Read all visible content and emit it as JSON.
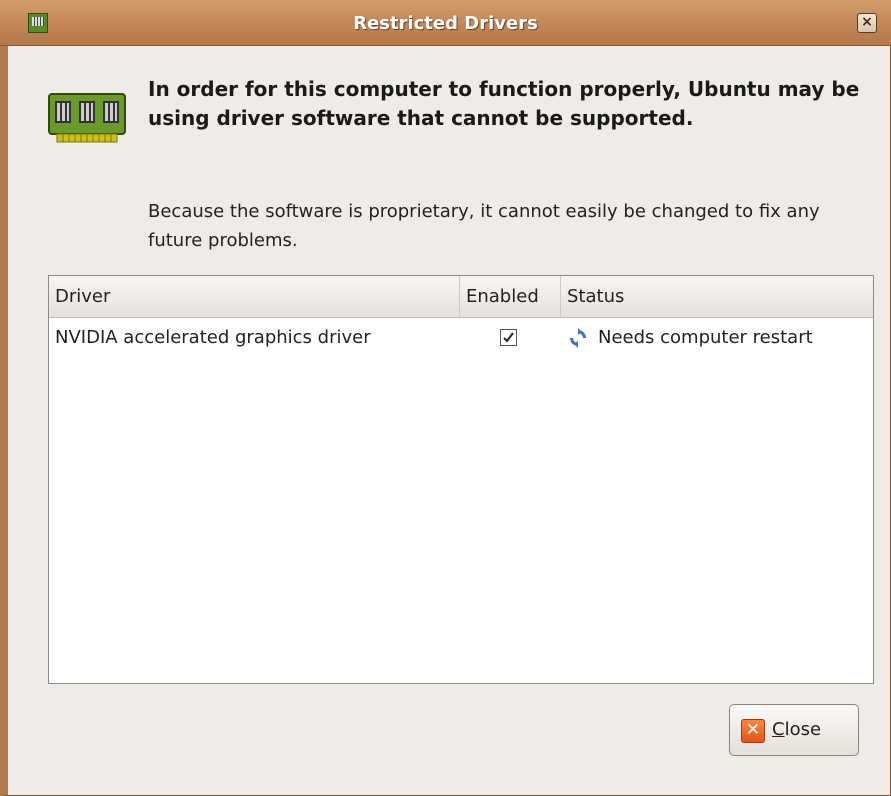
{
  "window": {
    "title": "Restricted Drivers",
    "close_glyph": "×"
  },
  "message": {
    "heading": "In order for this computer to function properly, Ubuntu may be using driver software that cannot be supported.",
    "description": "Because the software is proprietary, it cannot easily be changed to fix any future problems."
  },
  "table": {
    "columns": [
      "Driver",
      "Enabled",
      "Status"
    ],
    "rows": [
      {
        "driver": "NVIDIA accelerated graphics driver",
        "enabled": true,
        "status": "Needs computer restart",
        "status_icon": "restart-icon"
      }
    ]
  },
  "buttons": {
    "close_mnemonic": "C",
    "close_rest": "lose",
    "close_icon": "close-icon"
  },
  "colors": {
    "titlebar": "#c68b5b",
    "window_bg": "#efebe7",
    "close_icon_orange": "#e4561a",
    "restart_icon_blue": "#3a74c4"
  }
}
